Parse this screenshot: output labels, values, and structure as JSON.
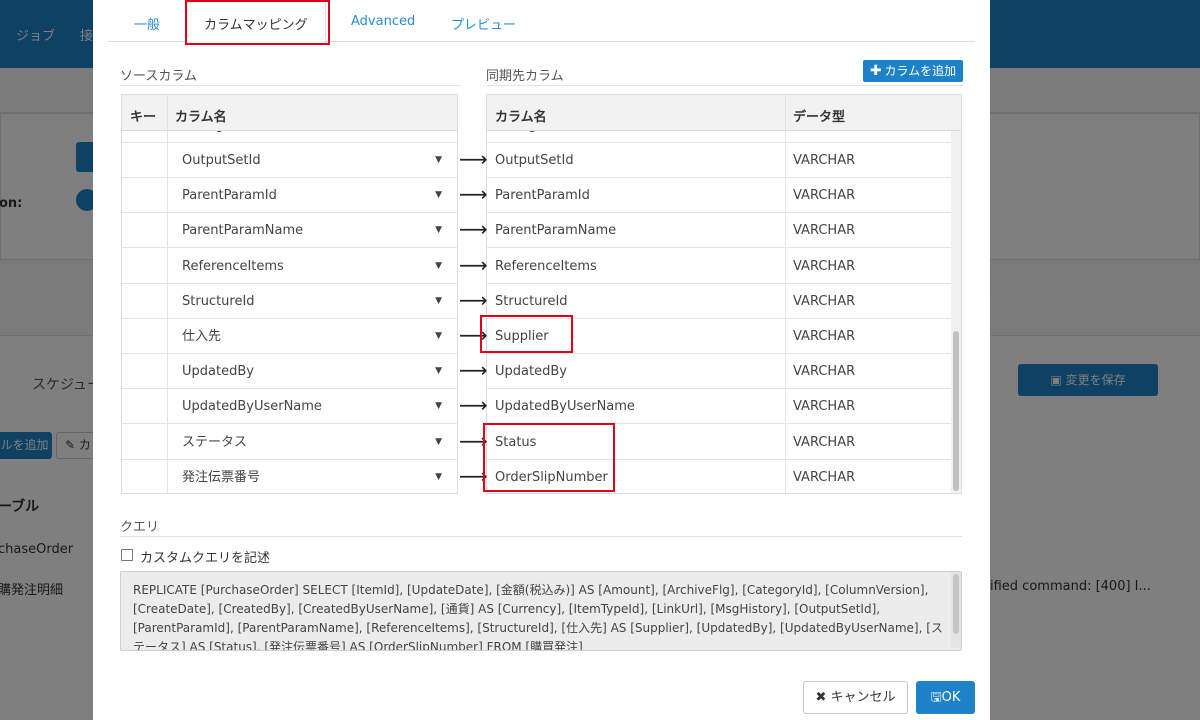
{
  "background": {
    "nav": [
      "ジョブ",
      "接"
    ],
    "field_label": "on:",
    "tab_schedule": "スケジュー",
    "save_button": "変更を保存",
    "add_table_button": "ルを追加",
    "copy_button": "カ",
    "table_heading": "ーブル",
    "table_rows": [
      "chaseOrder",
      "購発注明細"
    ],
    "error_text": "ified command: [400] I..."
  },
  "modal": {
    "tabs": [
      {
        "label": "一般"
      },
      {
        "label": "カラムマッピング"
      },
      {
        "label": "Advanced"
      },
      {
        "label": "プレビュー"
      }
    ],
    "source_label": "ソースカラム",
    "dest_label": "同期先カラム",
    "add_column_label": "カラムを追加",
    "source_headers": {
      "key": "キー",
      "name": "カラム名"
    },
    "dest_headers": {
      "name": "カラム名",
      "type": "データ型"
    },
    "partial_row": {
      "source": "ChangeStatus",
      "dest": "ChangeStatus"
    },
    "rows": [
      {
        "source": "OutputSetId",
        "dest": "OutputSetId",
        "type": "VARCHAR"
      },
      {
        "source": "ParentParamId",
        "dest": "ParentParamId",
        "type": "VARCHAR"
      },
      {
        "source": "ParentParamName",
        "dest": "ParentParamName",
        "type": "VARCHAR"
      },
      {
        "source": "ReferenceItems",
        "dest": "ReferenceItems",
        "type": "VARCHAR"
      },
      {
        "source": "StructureId",
        "dest": "StructureId",
        "type": "VARCHAR"
      },
      {
        "source": "仕入先",
        "dest": "Supplier",
        "type": "VARCHAR"
      },
      {
        "source": "UpdatedBy",
        "dest": "UpdatedBy",
        "type": "VARCHAR"
      },
      {
        "source": "UpdatedByUserName",
        "dest": "UpdatedByUserName",
        "type": "VARCHAR"
      },
      {
        "source": "ステータス",
        "dest": "Status",
        "type": "VARCHAR"
      },
      {
        "source": "発注伝票番号",
        "dest": "OrderSlipNumber",
        "type": "VARCHAR"
      }
    ],
    "query_label": "クエリ",
    "custom_query_label": "カスタムクエリを記述",
    "query_text": "REPLICATE [PurchaseOrder] SELECT [ItemId], [UpdateDate], [金額(税込み)] AS [Amount], [ArchiveFlg], [CategoryId], [ColumnVersion], [CreateDate], [CreatedBy], [CreatedByUserName], [通貨] AS [Currency], [ItemTypeId], [LinkUrl], [MsgHistory], [OutputSetId], [ParentParamId], [ParentParamName], [ReferenceItems], [StructureId], [仕入先] AS [Supplier], [UpdatedBy], [UpdatedByUserName], [ステータス] AS [Status], [発注伝票番号] AS [OrderSlipNumber] FROM [購買発注]",
    "cancel_label": "キャンセル",
    "ok_label": "OK"
  },
  "colors": {
    "accent": "#1e82c8",
    "highlight": "#e2001a"
  },
  "icons": [
    "plus-icon",
    "arrow-right-icon",
    "caret-down-icon",
    "times-icon",
    "floppy-disk-icon"
  ]
}
